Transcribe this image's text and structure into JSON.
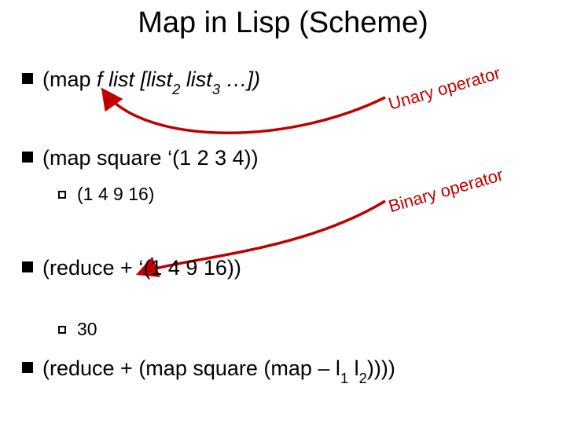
{
  "title": "Map in Lisp (Scheme)",
  "bullets": {
    "map_sig_prefix": "(map ",
    "map_sig_italic_f": "f",
    "map_sig_mid": " ",
    "map_sig_italic_list": "list",
    "map_sig_bracket_open": " [",
    "map_sig_italic_list2": "list",
    "map_sig_sub2": "2",
    "map_sig_sep": " ",
    "map_sig_italic_list3": "list",
    "map_sig_sub3": "3",
    "map_sig_end": " …])",
    "map_example": "(map square ‘(1 2 3 4))",
    "map_result": "(1 4 9 16)",
    "reduce_example": "(reduce + ‘(1 4 9 16))",
    "reduce_result": "30",
    "compose_prefix": "(reduce + (map square (map – l",
    "compose_sub1": "1",
    "compose_mid": " l",
    "compose_sub2": "2",
    "compose_end": "))))"
  },
  "annotations": {
    "unary": "Unary operator",
    "binary": "Binary operator"
  }
}
